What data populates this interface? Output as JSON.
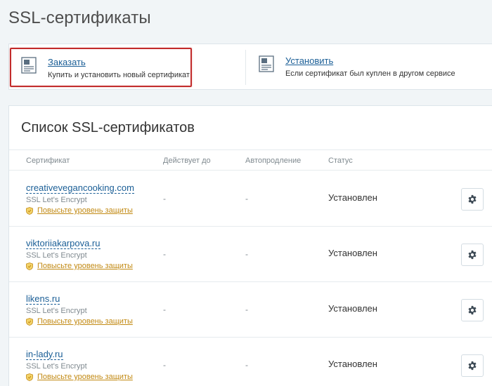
{
  "page": {
    "title": "SSL-сертификаты"
  },
  "actions": {
    "order": {
      "label": "Заказать",
      "description": "Купить и установить новый сертификат",
      "icon": "certificate-icon"
    },
    "install": {
      "label": "Установить",
      "description": "Если сертификат был куплен в другом сервисе",
      "icon": "certificate-icon"
    }
  },
  "list": {
    "title": "Список SSL-сертификатов",
    "columns": {
      "certificate": "Сертификат",
      "valid_until": "Действует до",
      "auto_renew": "Автопродление",
      "status": "Статус"
    },
    "rows": [
      {
        "domain": "creativevegancooking.com",
        "type": "SSL Let's Encrypt",
        "upgrade": "Повысьте уровень защиты",
        "valid_until": "-",
        "auto_renew": "-",
        "status": "Установлен"
      },
      {
        "domain": "viktoriiakarpova.ru",
        "type": "SSL Let's Encrypt",
        "upgrade": "Повысьте уровень защиты",
        "valid_until": "-",
        "auto_renew": "-",
        "status": "Установлен"
      },
      {
        "domain": "likens.ru",
        "type": "SSL Let's Encrypt",
        "upgrade": "Повысьте уровень защиты",
        "valid_until": "-",
        "auto_renew": "-",
        "status": "Установлен"
      },
      {
        "domain": "in-lady.ru",
        "type": "SSL Let's Encrypt",
        "upgrade": "Повысьте уровень защиты",
        "valid_until": "-",
        "auto_renew": "-",
        "status": "Установлен"
      }
    ]
  },
  "colors": {
    "link": "#1a5e96",
    "upgrade_link": "#c28a14",
    "highlight_border": "#c22b2b",
    "background": "#f1f5f7"
  }
}
